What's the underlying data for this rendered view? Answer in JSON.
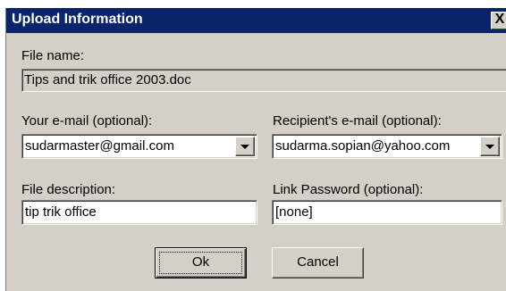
{
  "window": {
    "title": "Upload Information",
    "close_glyph": "X"
  },
  "file_name": {
    "label": "File name:",
    "value": "Tips and trik office 2003.doc"
  },
  "your_email": {
    "label": "Your e-mail (optional):",
    "value": "sudarmaster@gmail.com"
  },
  "recipient_email": {
    "label": "Recipient's e-mail (optional):",
    "value": "sudarma.sopian@yahoo.com"
  },
  "file_description": {
    "label": "File description:",
    "value": "tip trik office"
  },
  "link_password": {
    "label": "Link Password (optional):",
    "value": "[none]"
  },
  "buttons": {
    "ok": "Ok",
    "cancel": "Cancel"
  },
  "colors": {
    "titlebar": "#0a246a",
    "dialog_face": "#d4d0c8"
  },
  "icons": {
    "close": "close-icon",
    "dropdown": "chevron-down-icon"
  }
}
